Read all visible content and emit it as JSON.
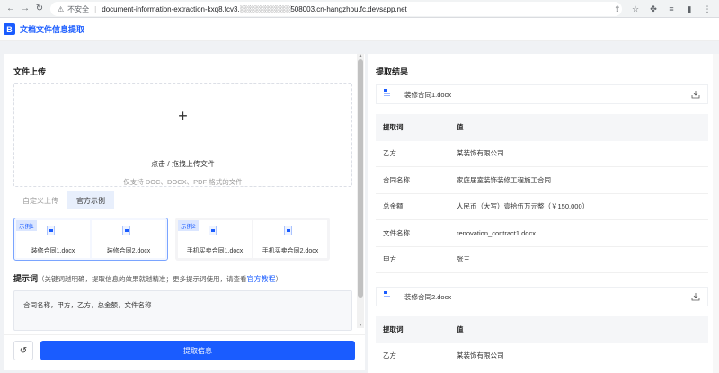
{
  "browser": {
    "back": "←",
    "forward": "→",
    "reload": "↻",
    "insecure_label": "不安全",
    "url": "document-information-extraction-kxq8.fcv3.░░░░░░░░░░508003.cn-hangzhou.fc.devsapp.net"
  },
  "app": {
    "logo_letter": "B",
    "title": "文档文件信息提取"
  },
  "left": {
    "upload_title": "文件上传",
    "upload_plus": "+",
    "upload_text": "点击 / 拖拽上传文件",
    "upload_hint": "仅支持 DOC、DOCX、PDF 格式的文件",
    "tabs": [
      {
        "label": "自定义上传"
      },
      {
        "label": "官方示例"
      }
    ],
    "sample_groups": [
      {
        "tag": "示例1",
        "files": [
          "装修合同1.docx",
          "装修合同2.docx"
        ]
      },
      {
        "tag": "示例2",
        "files": [
          "手机买卖合同1.docx",
          "手机买卖合同2.docx"
        ]
      }
    ],
    "prompt_title": "提示词",
    "prompt_hint_before": "（关键词越明确，提取信息的效果就越精准；更多提示词使用，请查看",
    "prompt_hint_link": "官方教程",
    "prompt_hint_after": "）",
    "prompt_value": "合同名称，甲方，乙方，总金额，文件名称",
    "reset_icon": "↺",
    "extract_button": "提取信息"
  },
  "right": {
    "title": "提取结果",
    "col_key": "提取词",
    "col_value": "值",
    "results": [
      {
        "file": "装修合同1.docx",
        "rows": [
          {
            "k": "乙方",
            "v": "某装饰有限公司"
          },
          {
            "k": "合同名称",
            "v": "家庭居室装饰装修工程施工合同"
          },
          {
            "k": "总金额",
            "v": "人民币（大写）壹拾伍万元整（￥150,000）"
          },
          {
            "k": "文件名称",
            "v": "renovation_contract1.docx"
          },
          {
            "k": "甲方",
            "v": "张三"
          }
        ]
      },
      {
        "file": "装修合同2.docx",
        "rows": [
          {
            "k": "乙方",
            "v": "某装饰有限公司"
          }
        ]
      }
    ]
  }
}
